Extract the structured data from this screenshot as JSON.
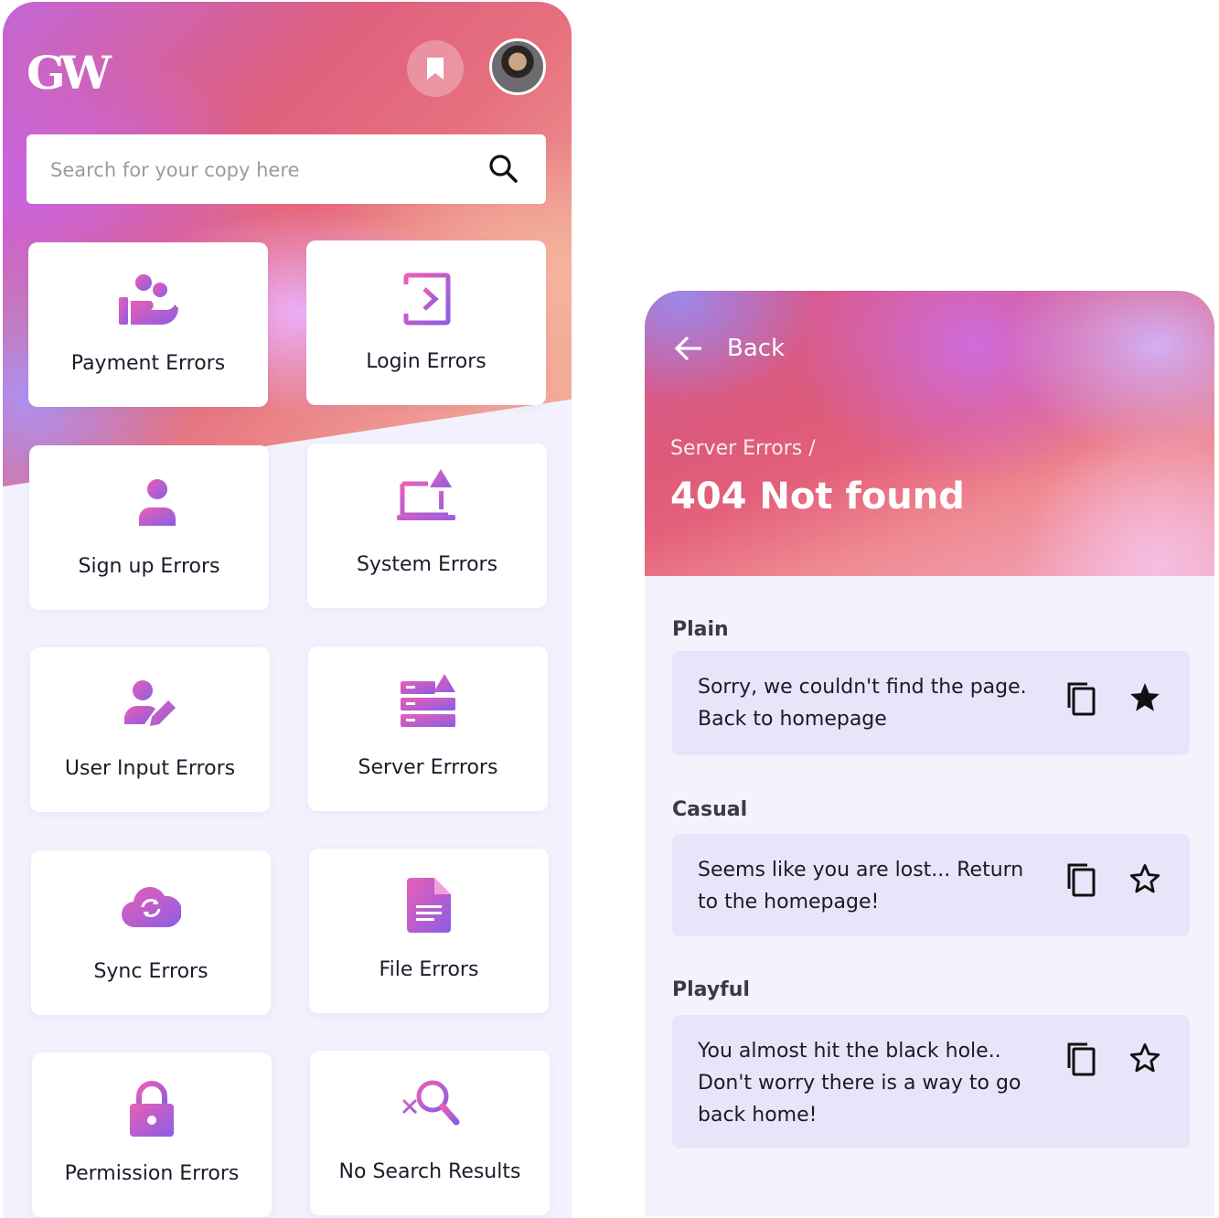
{
  "left": {
    "logo": "GW",
    "search": {
      "placeholder": "Search for your copy here"
    },
    "categories": [
      {
        "label": "Payment Errors",
        "icon": "payment-user-icon"
      },
      {
        "label": "Login Errors",
        "icon": "login-icon"
      },
      {
        "label": "Sign up Errors",
        "icon": "add-user-icon"
      },
      {
        "label": "System Errors",
        "icon": "laptop-warning-icon"
      },
      {
        "label": "User Input Errors",
        "icon": "user-edit-icon"
      },
      {
        "label": "Server Errrors",
        "icon": "server-warning-icon"
      },
      {
        "label": "Sync Errors",
        "icon": "cloud-sync-icon"
      },
      {
        "label": "File Errors",
        "icon": "file-icon"
      },
      {
        "label": "Permission Errors",
        "icon": "lock-icon"
      },
      {
        "label": "No Search Results",
        "icon": "search-x-icon"
      }
    ]
  },
  "right": {
    "back_label": "Back",
    "breadcrumb": "Server Errors /",
    "title": "404 Not found",
    "sections": [
      {
        "label": "Plain",
        "lines": [
          "Sorry, we couldn't find the page.",
          "Back to homepage"
        ],
        "favorited": true
      },
      {
        "label": "Casual",
        "lines": [
          "Seems like you are lost... Return",
          "to the homepage!"
        ],
        "favorited": false
      },
      {
        "label": "Playful",
        "lines": [
          "You almost hit the black hole..",
          "Don't worry there is a way to go",
          "back home!"
        ],
        "favorited": false
      }
    ]
  },
  "colors": {
    "icon_gradient_start": "#e55fbf",
    "icon_gradient_end": "#8a5de0",
    "background": "#f3f1fd"
  }
}
